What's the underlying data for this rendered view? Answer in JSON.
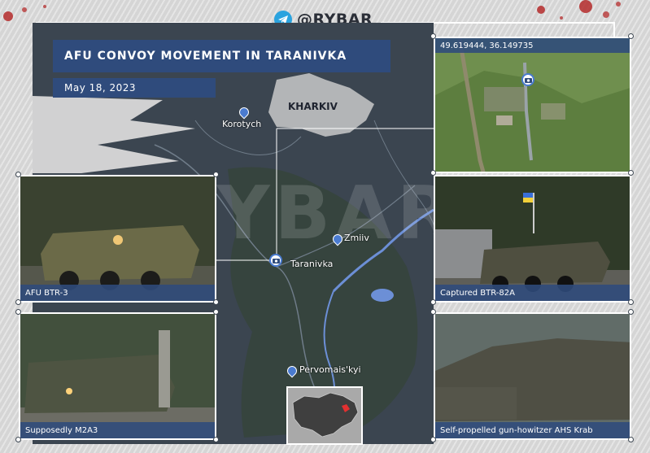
{
  "brand": {
    "handle": "@RYBAR",
    "icon": "telegram-icon",
    "watermark": "@RYBAR"
  },
  "map": {
    "title": "AFU CONVOY MOVEMENT IN TARANIVKA",
    "date": "May 18, 2023",
    "places": {
      "kharkiv": "KHARKIV",
      "korotych": "Korotych",
      "zmiiv": "Zmiiv",
      "taranivka": "Taranivka",
      "pervomaiskyi": "Pervomais'kyi"
    },
    "colors": {
      "accent": "#2f4b7c",
      "pin": "#4a7bd0",
      "water": "#6c8fd6",
      "city": "#cfcfcf"
    }
  },
  "photos": {
    "satellite": {
      "coords": "49.619444, 36.149735"
    },
    "btr3": {
      "caption": "AFU BTR-3"
    },
    "btr82a": {
      "caption": "Captured BTR-82A"
    },
    "m2a3": {
      "caption": "Supposedly M2A3"
    },
    "krab": {
      "caption": "Self-propelled gun-howitzer AHS Krab"
    }
  }
}
